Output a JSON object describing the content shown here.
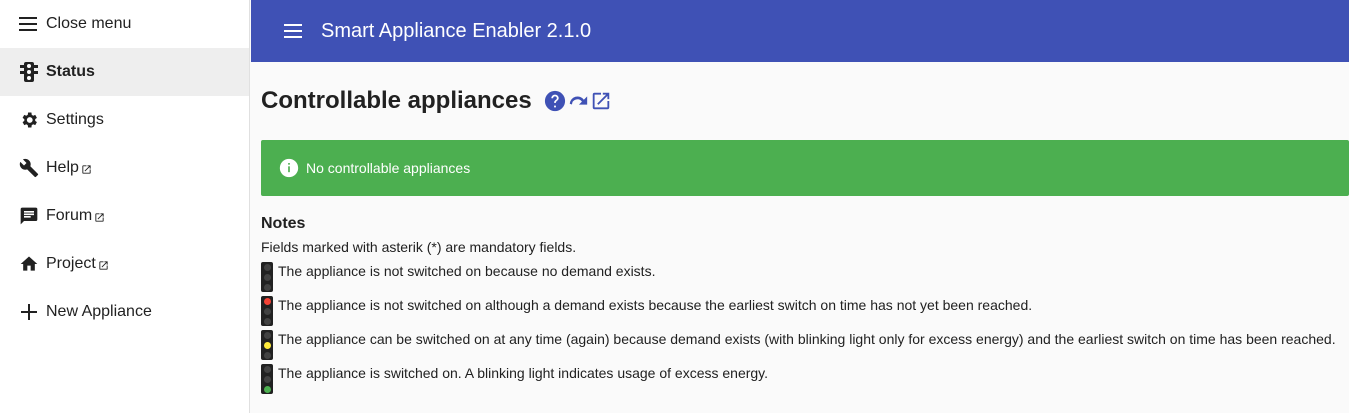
{
  "sidebar": {
    "items": [
      {
        "label": "Close menu",
        "icon": "hamburger-icon"
      },
      {
        "label": "Status",
        "icon": "traffic-light-icon"
      },
      {
        "label": "Settings",
        "icon": "gear-icon"
      },
      {
        "label": "Help",
        "icon": "wrench-icon"
      },
      {
        "label": "Forum",
        "icon": "forum-icon"
      },
      {
        "label": "Project",
        "icon": "home-icon"
      },
      {
        "label": "New Appliance",
        "icon": "plus-icon"
      }
    ],
    "active": "Status"
  },
  "toolbar": {
    "title": "Smart Appliance Enabler 2.1.0"
  },
  "main": {
    "title": "Controllable appliances",
    "info": "No controllable appliances",
    "notes": {
      "heading": "Notes",
      "mandatory": "Fields marked with asterik (*) are mandatory fields.",
      "legend": [
        "The appliance is not switched on because no demand exists.",
        "The appliance is not switched on although a demand exists because the earliest switch on time has not yet been reached.",
        "The appliance can be switched on at any time (again) because demand exists (with blinking light only for excess energy) and the earliest switch on time has been reached.",
        "The appliance is switched on. A blinking light indicates usage of excess energy."
      ]
    }
  },
  "colors": {
    "primary": "#3f51b5",
    "success": "#4caf50",
    "red": "#f44336",
    "yellow": "#ffeb3b",
    "green": "#4caf50"
  }
}
